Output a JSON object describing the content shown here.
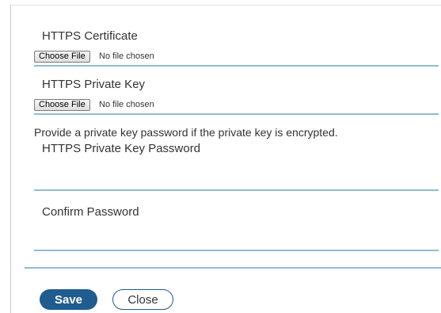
{
  "https_certificate": {
    "label": "HTTPS Certificate",
    "button_label": "Choose File",
    "status": "No file chosen"
  },
  "https_private_key": {
    "label": "HTTPS Private Key",
    "button_label": "Choose File",
    "status": "No file chosen"
  },
  "private_key_info": "Provide a private key password if the private key is encrypted.",
  "private_key_password": {
    "label": "HTTPS Private Key Password",
    "value": ""
  },
  "confirm_password": {
    "label": "Confirm Password",
    "value": ""
  },
  "actions": {
    "save_label": "Save",
    "close_label": "Close"
  },
  "colors": {
    "primary": "#1f5c8f",
    "underline": "#8fbcd3",
    "text": "#333333"
  }
}
